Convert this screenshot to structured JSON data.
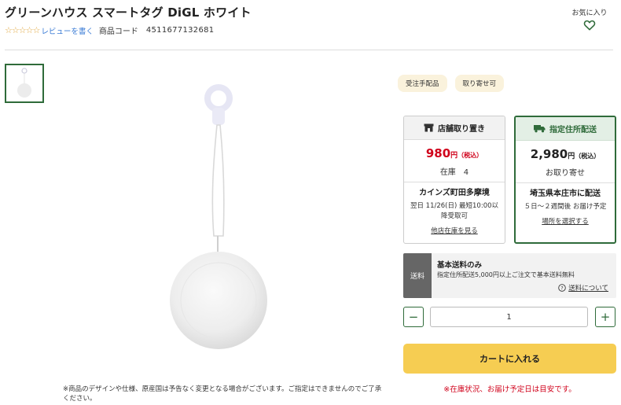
{
  "product": {
    "title": "グリーンハウス スマートタグ DiGL ホワイト",
    "stars": "☆☆☆☆☆",
    "review_link": "レビューを書く",
    "code_label": "商品コード",
    "code_value": "4511677132681",
    "disclaimer": "※商品のデザインや仕様、原産国は予告なく変更となる場合がございます。ご指定はできませんのでご了承ください。"
  },
  "favorite": {
    "label": "お気に入り",
    "icon": "heart-icon"
  },
  "badges": [
    "受注手配品",
    "取り寄せ可"
  ],
  "store_pickup": {
    "header": "店舗取り置き",
    "icon": "store-icon",
    "price": "980",
    "unit": "円",
    "tax": "（税込）",
    "stock": "在庫　4",
    "shop": "カインズ町田多摩境",
    "note": "翌日 11/26(日) 最短10:00以降受取可",
    "link": "他店在庫を見る"
  },
  "home_delivery": {
    "header": "指定住所配送",
    "icon": "truck-icon",
    "price": "2,980",
    "unit": "円",
    "tax": "（税込）",
    "stock": "お取り寄せ",
    "destination": "埼玉県本庄市に配送",
    "note": "５日〜２週間後 お届け予定",
    "link": "場所を選択する"
  },
  "shipping": {
    "tag": "送料",
    "title": "基本送料のみ",
    "desc": "指定住所配送5,000円以上ご注文で基本送料無料",
    "link": "送料について",
    "link_icon": "question-icon"
  },
  "quantity": {
    "minus": "−",
    "value": "1",
    "plus": "+"
  },
  "cart_button": "カートに入れる",
  "notice": "※在庫状況、お届け予定日は目安です。",
  "colors": {
    "accent_green": "#2f6b3a",
    "price_red": "#d0021b",
    "cart_yellow": "#f6cd52"
  }
}
